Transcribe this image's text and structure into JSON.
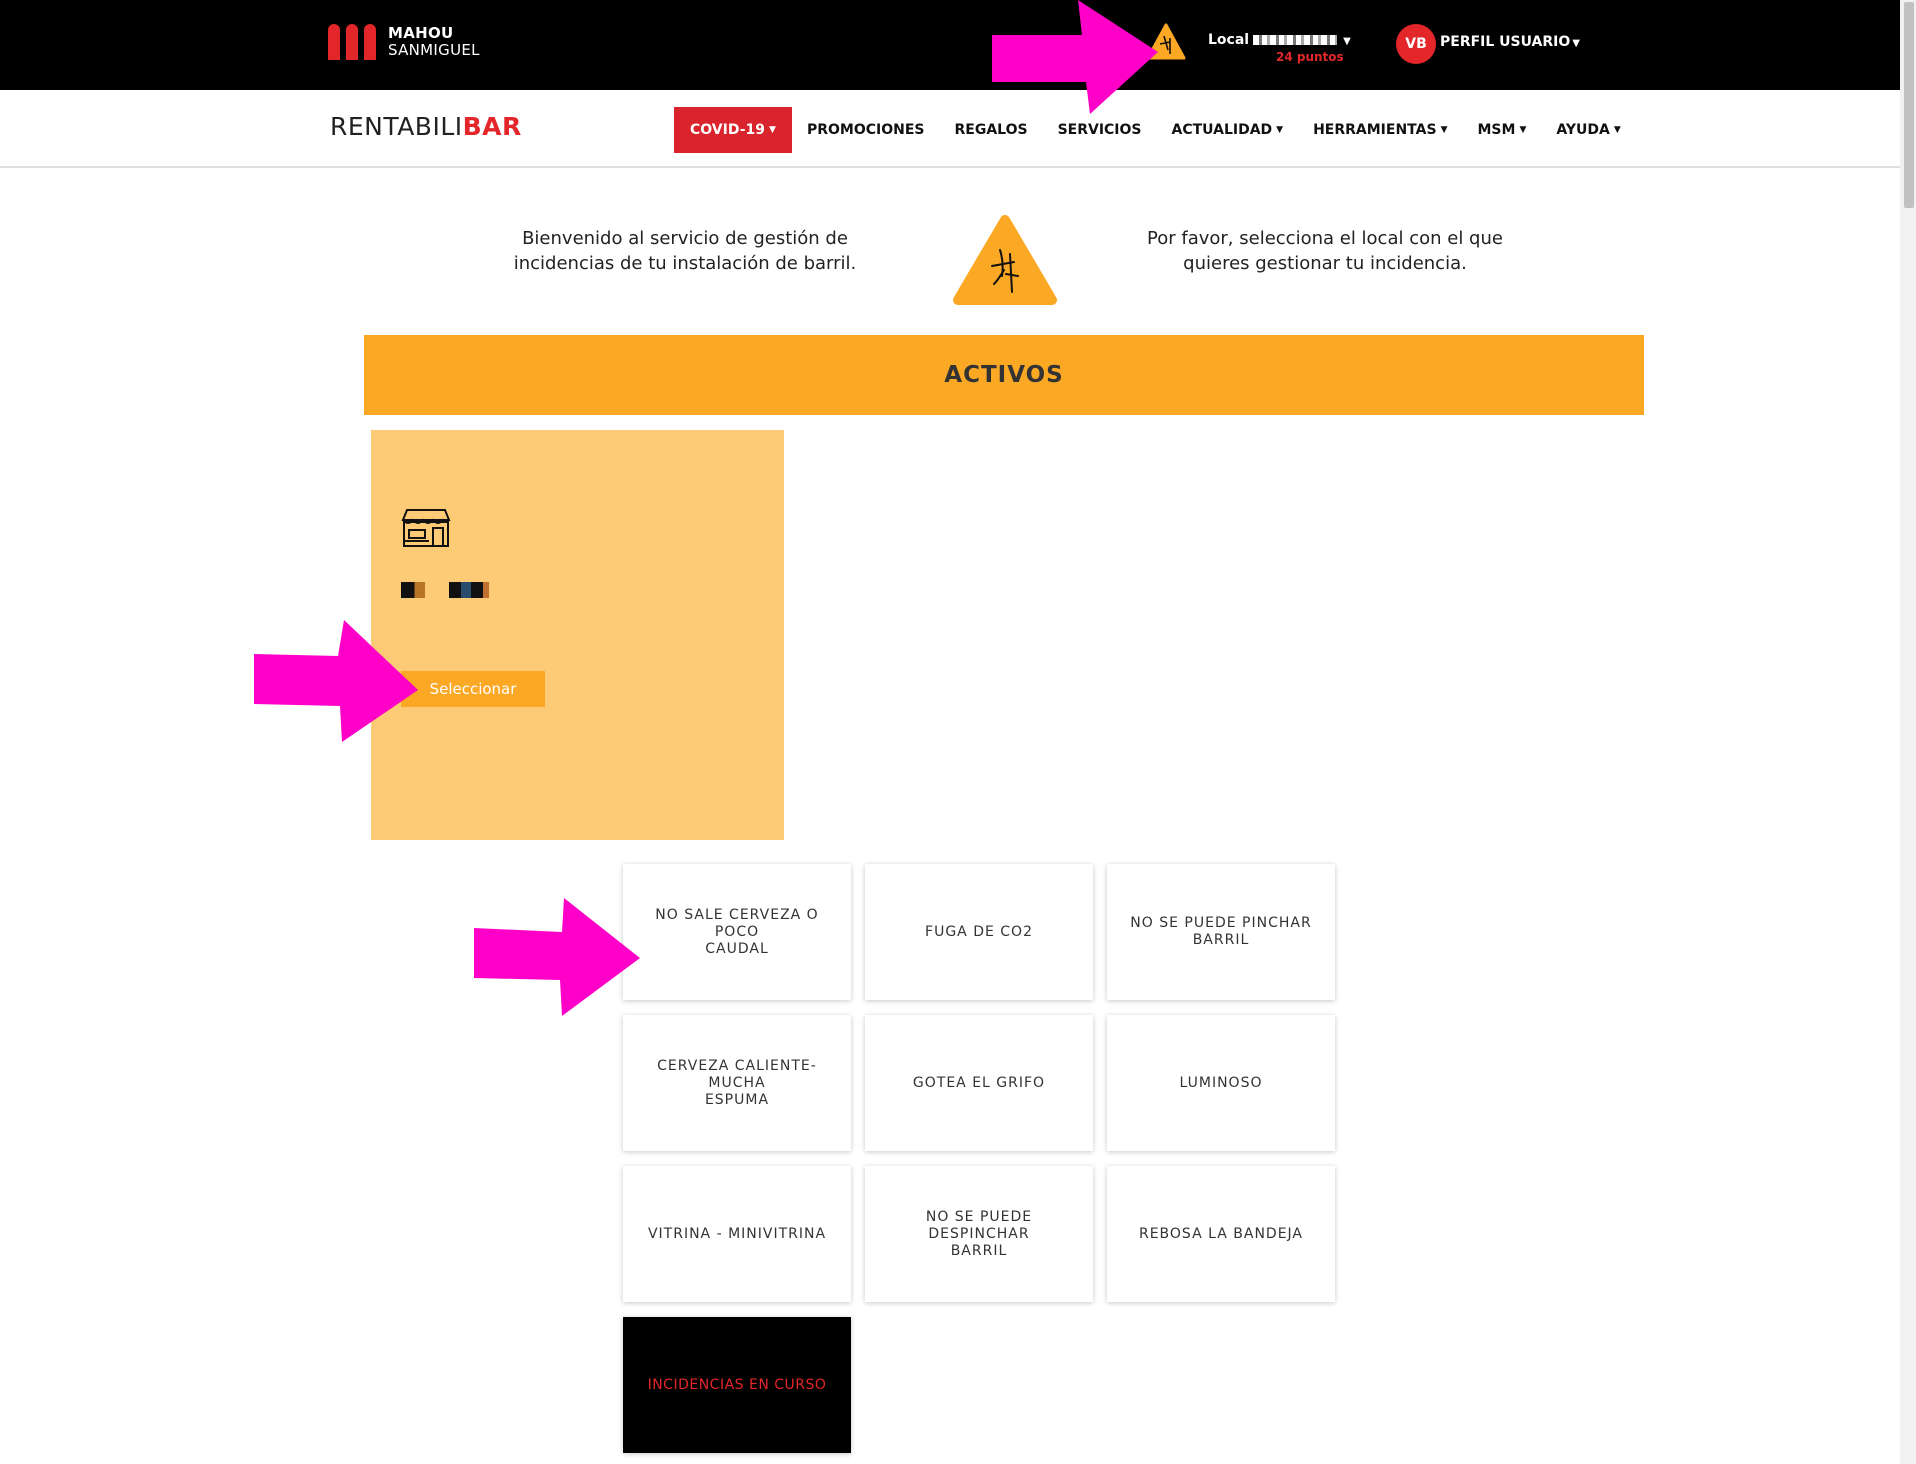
{
  "brand": {
    "line1": "MAHOU",
    "line2": "SANMIGUEL"
  },
  "topbar": {
    "local_label": "Local",
    "points": "24 puntos",
    "avatar_initials": "VB",
    "profile_label": "PERFIL USUARIO"
  },
  "logo": {
    "part1": "RENTABILI",
    "part2": "BAR"
  },
  "nav": {
    "items": [
      {
        "label": "COVID-19",
        "dropdown": true
      },
      {
        "label": "PROMOCIONES",
        "dropdown": false
      },
      {
        "label": "REGALOS",
        "dropdown": false
      },
      {
        "label": "SERVICIOS",
        "dropdown": false
      },
      {
        "label": "ACTUALIDAD",
        "dropdown": true
      },
      {
        "label": "HERRAMIENTAS",
        "dropdown": true
      },
      {
        "label": "MSM",
        "dropdown": true
      },
      {
        "label": "AYUDA",
        "dropdown": true
      }
    ]
  },
  "intro": {
    "left_line1": "Bienvenido al servicio de gestión de",
    "left_line2": "incidencias de tu instalación de barril.",
    "right_line1": "Por favor, selecciona el local con el que",
    "right_line2": "quieres gestionar tu incidencia."
  },
  "activos": {
    "title": "ACTIVOS",
    "select_button": "Seleccionar"
  },
  "incidences": {
    "items": [
      {
        "line1": "NO SALE CERVEZA O POCO",
        "line2": "CAUDAL"
      },
      {
        "line1": "FUGA DE CO2",
        "line2": ""
      },
      {
        "line1": "NO SE PUEDE PINCHAR",
        "line2": "BARRIL"
      },
      {
        "line1": "CERVEZA CALIENTE-MUCHA",
        "line2": "ESPUMA"
      },
      {
        "line1": "GOTEA EL GRIFO",
        "line2": ""
      },
      {
        "line1": "LUMINOSO",
        "line2": ""
      },
      {
        "line1": "VITRINA - MINIVITRINA",
        "line2": ""
      },
      {
        "line1": "NO SE PUEDE DESPINCHAR",
        "line2": "BARRIL"
      },
      {
        "line1": "REBOSA LA BANDEJA",
        "line2": ""
      }
    ],
    "in_progress": "INCIDENCIAS EN CURSO"
  },
  "colors": {
    "brand_red": "#e2262a",
    "covid_red": "#d9232d",
    "orange": "#fba825",
    "light_orange": "#fdca76",
    "annotation_magenta": "#ff00c8"
  },
  "icons": [
    "barrel-tap-warning-icon",
    "shop-icon",
    "annotation-arrow"
  ]
}
